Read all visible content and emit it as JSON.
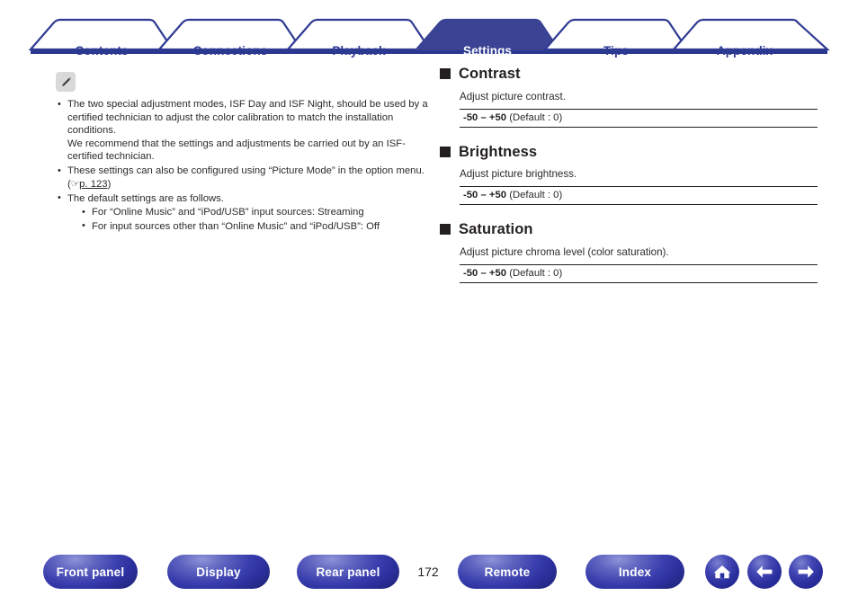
{
  "tabs": [
    {
      "label": "Contents",
      "active": false
    },
    {
      "label": "Connections",
      "active": false
    },
    {
      "label": "Playback",
      "active": false
    },
    {
      "label": "Settings",
      "active": true
    },
    {
      "label": "Tips",
      "active": false
    },
    {
      "label": "Appendix",
      "active": false
    }
  ],
  "note": {
    "icon": "pencil-note-icon",
    "bullets": [
      "The two special adjustment modes, ISF Day and ISF Night, should be used by a certified technician to adjust the color calibration to match the installation conditions.",
      "We recommend that the settings and adjustments be carried out by an ISF-certified technician.",
      "These settings can also be configured using “Picture Mode” in the option menu.",
      "The default settings are as follows."
    ],
    "bullet1_line1": "The two special adjustment modes, ISF Day and ISF Night, should be used by a certified technician to adjust the color calibration to match the installation conditions.",
    "bullet1_line2": "We recommend that the settings and adjustments be carried out by an ISF-certified technician.",
    "bullet2_text": "These settings can also be configured using “Picture Mode” in the option menu.",
    "page_ref_hand": "☞",
    "page_ref_link": "p. 123",
    "bullet3_text": "The default settings are as follows.",
    "sub_bullets": [
      "For “Online Music” and “iPod/USB” input sources: Streaming",
      "For input sources other than “Online Music” and “iPod/USB”: Off"
    ]
  },
  "sections": [
    {
      "title": "Contrast",
      "description": "Adjust picture contrast.",
      "range": "-50 – +50",
      "default": "(Default : 0)"
    },
    {
      "title": "Brightness",
      "description": "Adjust picture brightness.",
      "range": "-50 – +50",
      "default": "(Default : 0)"
    },
    {
      "title": "Saturation",
      "description": "Adjust picture chroma level (color saturation).",
      "range": "-50 – +50",
      "default": "(Default : 0)"
    }
  ],
  "footer": {
    "buttons": [
      {
        "label": "Front panel"
      },
      {
        "label": "Display"
      },
      {
        "label": "Rear panel"
      },
      {
        "label": "Remote"
      },
      {
        "label": "Index"
      }
    ],
    "page_number": "172",
    "icons": [
      {
        "name": "home-icon"
      },
      {
        "name": "back-arrow-icon"
      },
      {
        "name": "forward-arrow-icon"
      }
    ]
  },
  "colors": {
    "brand_indigo": "#2f3a92",
    "tab_bar_baseline": "#2a3890",
    "active_tab_fill": "#3b4395",
    "text": "#231f20",
    "note_icon_bg": "#d9d9d9"
  }
}
